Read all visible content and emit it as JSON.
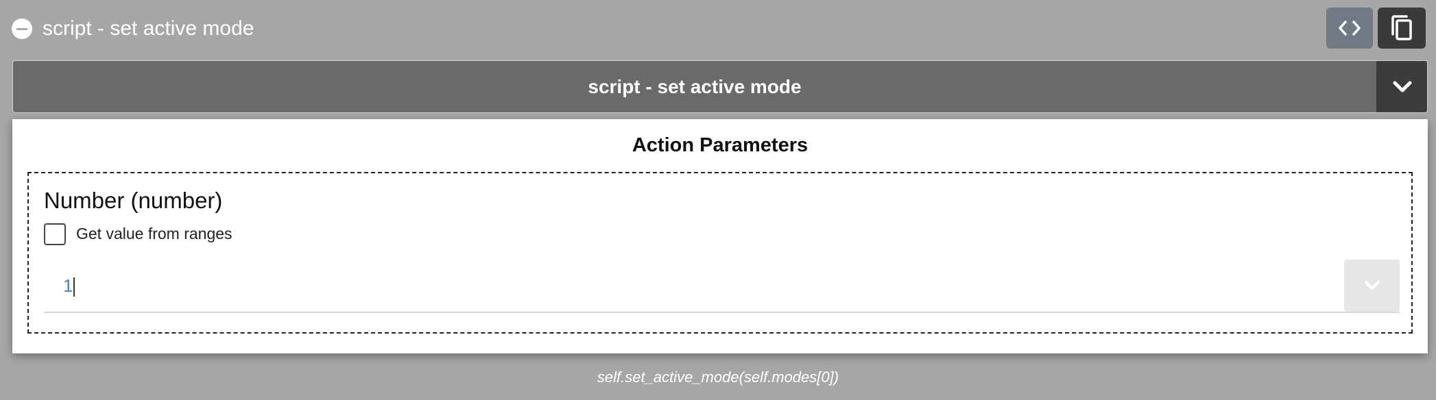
{
  "header": {
    "title": "script - set active mode",
    "collapse_icon": "minus-circle-icon",
    "code_icon": "code-icon",
    "copy_icon": "copy-icon"
  },
  "action_select": {
    "selected": "script - set active mode",
    "caret_icon": "chevron-down-icon"
  },
  "panel": {
    "title": "Action Parameters",
    "parameter": {
      "name": "Number (number)",
      "checkbox_label": "Get value from ranges",
      "checkbox_checked": false,
      "value": "1",
      "caret_icon": "chevron-down-icon"
    }
  },
  "footer": {
    "code": "self.set_active_mode(self.modes[0])"
  },
  "colors": {
    "background": "#a6a6a6",
    "select_bar": "#6a6a6a",
    "value_text": "#3a88d8"
  }
}
